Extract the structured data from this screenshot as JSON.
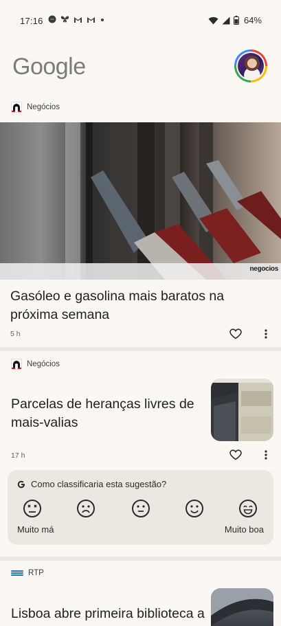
{
  "status_bar": {
    "time": "17:16",
    "battery": "64%",
    "notification_icons": [
      "messenger-icon",
      "butterfly-icon",
      "gmail-icon",
      "gmail-icon",
      "dot-icon"
    ]
  },
  "header": {
    "logo": "Google"
  },
  "cards": [
    {
      "source": "Negócios",
      "title": "Gasóleo e gasolina mais baratos na próxima semana",
      "time": "5 h",
      "image_watermark": "negocios"
    },
    {
      "source": "Negócios",
      "title": "Parcelas de heranças livres de mais-valias",
      "time": "17 h"
    },
    {
      "source": "RTP",
      "title": "Lisboa abre primeira biblioteca a"
    }
  ],
  "feedback": {
    "question": "Como classificaria esta sugestão?",
    "low_label": "Muito má",
    "high_label": "Muito boa",
    "ratings": [
      "very-bad-face-icon",
      "bad-face-icon",
      "neutral-face-icon",
      "good-face-icon",
      "very-good-face-icon"
    ]
  },
  "colors": {
    "background": "#fbf8f3",
    "divider": "#ece9e4",
    "feedback_bg": "#ece8e1",
    "negocios_red": "#d0021b",
    "rtp_blue": "#2f6fb5"
  }
}
